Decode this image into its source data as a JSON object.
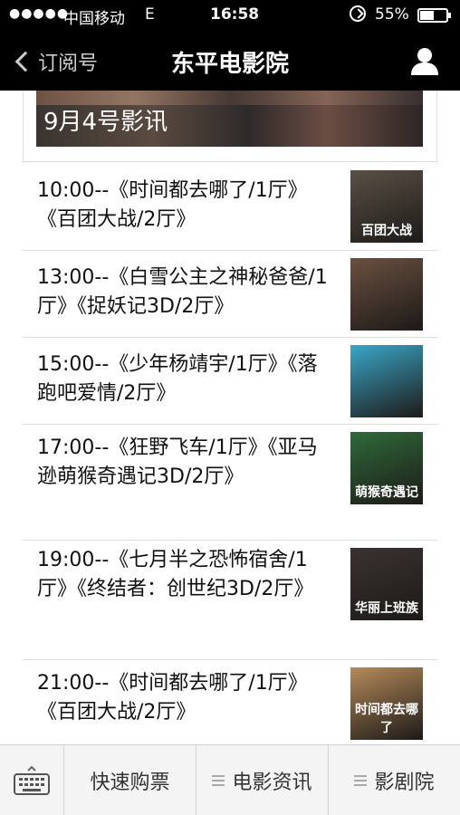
{
  "status_bar": {
    "signal": "●●●●●",
    "carrier": "中国移动",
    "network": "E",
    "time": "16:58",
    "battery_pct": "55%",
    "battery_level": 0.55
  },
  "nav": {
    "back_label": "订阅号",
    "title": "东平电影院",
    "profile_icon": "person-icon"
  },
  "banner": {
    "title": "9月4号影讯"
  },
  "schedule": [
    {
      "text": "10:00--《时间都去哪了/1厅》《百团大战/2厅》",
      "poster_caption": "百团大战",
      "poster_color": "#5a5046"
    },
    {
      "text": "13:00--《白雪公主之神秘爸爸/1厅》《捉妖记3D/2厅》",
      "poster_caption": "",
      "poster_color": "#6a5040"
    },
    {
      "text": "15:00--《少年杨靖宇/1厅》《落跑吧爱情/2厅》",
      "poster_caption": "",
      "poster_color": "#3aa6c8"
    },
    {
      "text": "17:00--《狂野飞车/1厅》《亚马逊萌猴奇遇记3D/2厅》",
      "poster_caption": "萌猴奇遇记",
      "poster_color": "#2f6a3a"
    },
    {
      "text": "19:00--《七月半之恐怖宿舍/1厅》《终结者：创世纪3D/2厅》",
      "poster_caption": "华丽上班族",
      "poster_color": "#3a3230"
    },
    {
      "text": "21:00--《时间都去哪了/1厅》《百团大战/2厅》",
      "poster_caption": "时间都去哪了",
      "poster_color": "#b58a5a"
    }
  ],
  "bottom_bar": {
    "keyboard_icon": "keyboard-icon",
    "tab1": "快速购票",
    "tab2": "电影资讯",
    "tab3": "影剧院"
  }
}
